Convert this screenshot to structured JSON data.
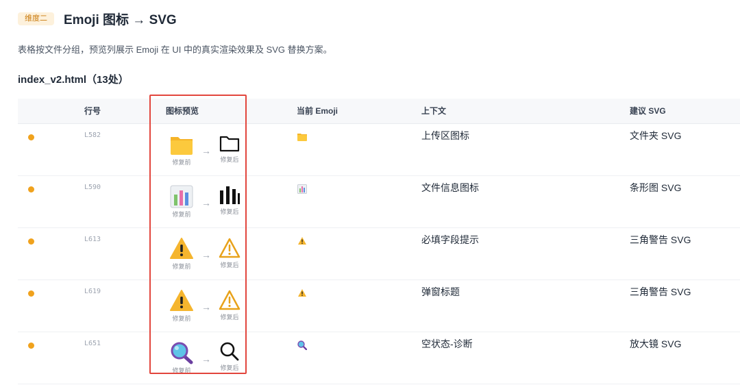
{
  "header": {
    "badge": "维度二",
    "title": "Emoji 图标 → SVG",
    "description": "表格按文件分组，预览列展示 Emoji 在 UI 中的真实渲染效果及 SVG 替换方案。"
  },
  "file_group": {
    "title": "index_v2.html（13处）"
  },
  "table": {
    "columns": [
      "行号",
      "图标预览",
      "当前 Emoji",
      "上下文",
      "建议 SVG"
    ],
    "preview_before_label": "修复前",
    "preview_after_label": "修复后",
    "rows": [
      {
        "line": "L582",
        "emoji_icon": "folder-emoji-icon",
        "svg_icon": "folder-outline-icon",
        "context": "上传区图标",
        "suggestion": "文件夹 SVG"
      },
      {
        "line": "L590",
        "emoji_icon": "bar-chart-emoji-icon",
        "svg_icon": "bar-chart-icon",
        "context": "文件信息图标",
        "suggestion": "条形图 SVG"
      },
      {
        "line": "L613",
        "emoji_icon": "warning-emoji-icon",
        "svg_icon": "warning-outline-icon",
        "context": "必填字段提示",
        "suggestion": "三角警告 SVG"
      },
      {
        "line": "L619",
        "emoji_icon": "warning-emoji-icon",
        "svg_icon": "warning-outline-icon",
        "context": "弹窗标题",
        "suggestion": "三角警告 SVG"
      },
      {
        "line": "L651",
        "emoji_icon": "magnifier-emoji-icon",
        "svg_icon": "search-icon",
        "context": "空状态-诊断",
        "suggestion": "放大镜 SVG"
      }
    ]
  },
  "colors": {
    "badge_bg": "#fdf1dc",
    "badge_text": "#c97a0c",
    "status_dot": "#f0a21d",
    "highlight_border": "#e2453c",
    "warning_outline": "#e8a21a"
  }
}
